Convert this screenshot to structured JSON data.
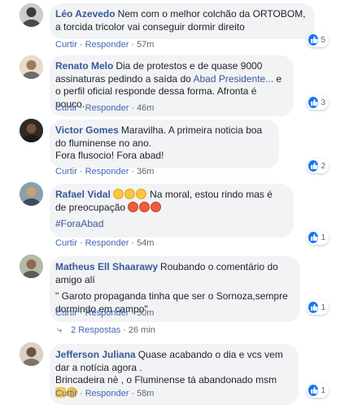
{
  "comments": [
    {
      "author": "Léo Azevedo",
      "text": "Nem com o melhor colchão da ORTOBOM, a torcida tricolor vai conseguir dormir direito",
      "actions": {
        "like": "Curtir",
        "reply": "Responder",
        "time": "57m"
      },
      "reaction_count": "5"
    },
    {
      "author": "Renato Melo",
      "text_before": "Dia de protestos e de quase 9000 assinaturas pedindo a saída do ",
      "link": "Abad Presidente...",
      "text_after": " e o perfil oficial responde dessa forma. Afronta é pouco.",
      "actions": {
        "like": "Curtir",
        "reply": "Responder",
        "time": "46m"
      },
      "reaction_count": "3"
    },
    {
      "author": "Victor Gomes",
      "text": "Maravilha. A primeira noticia boa do fluminense no ano.",
      "text2": "Fora flusocio! Fora abad!",
      "actions": {
        "like": "Curtir",
        "reply": "Responder",
        "time": "36m"
      },
      "reaction_count": "2"
    },
    {
      "author": "Rafael Vidal",
      "text": "Na moral, estou rindo mas é de preocupação",
      "hashtag": "#ForaAbad",
      "actions": {
        "like": "Curtir",
        "reply": "Responder",
        "time": "54m"
      },
      "reaction_count": "1"
    },
    {
      "author": "Matheus Ell Shaarawy",
      "text": "Roubando o comentário do amigo alí",
      "text2": "\" Garoto propaganda tinha que ser o Sornoza,sempre dormindo em campo\"",
      "actions": {
        "like": "Curtir",
        "reply": "Responder",
        "time": "50m"
      },
      "reaction_count": "1",
      "replies": {
        "label": "2 Respostas",
        "time": "26 min"
      }
    },
    {
      "author": "Jefferson Juliana",
      "text": "Quase acabando o dia e vcs vem dar a notícia agora .",
      "text2": "Brincadeira nè , o Fluminense tá abandonado msm",
      "actions": {
        "like": "Curtir",
        "reply": "Responder",
        "time": "58m"
      },
      "reaction_count": "1"
    }
  ],
  "colors": {
    "bubble": "#f2f3f5",
    "author": "#385898",
    "action": "#4267b2",
    "meta": "#606770",
    "like": "#1877f2"
  },
  "icons": [
    "like-icon",
    "laughing-emoji",
    "angry-emoji",
    "reply-arrow-icon"
  ]
}
